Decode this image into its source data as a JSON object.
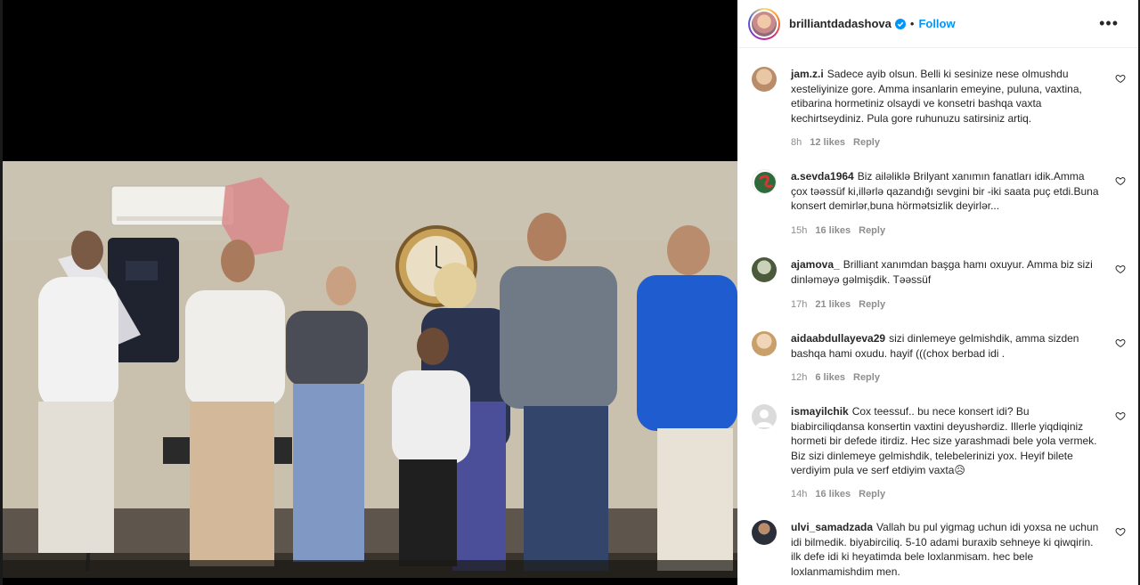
{
  "header": {
    "username": "brilliantdadashova",
    "separator": "•",
    "follow_label": "Follow",
    "more_label": "•••",
    "accent": "#0095f6"
  },
  "comments": [
    {
      "username": "jam.z.i",
      "text": "Sadece ayib olsun. Belli ki sesinize nese olmushdu xesteliyinize gore. Amma insanlarin emeyine, puluna, vaxtina, etibarina hormetiniz olsaydi ve konsetri bashqa vaxta kechirtseydiniz. Pula gore ruhunuzu satirsiniz artiq.",
      "time": "8h",
      "likes": "12 likes",
      "reply": "Reply",
      "avatar_color": "#d9b08c"
    },
    {
      "username": "a.sevda1964",
      "text": "Biz ailəliklə Brilyant xanımın fanatları idik.Amma çox təəssüf ki,illərlə qazandığı sevgini bir -iki saata puç etdi.Buna konsert demirlər,buna hörmətsizlik deyirlər...",
      "time": "15h",
      "likes": "16 likes",
      "reply": "Reply",
      "avatar_color": "#2f6b3a"
    },
    {
      "username": "ajamova_",
      "text": "Brilliant xanımdan başga hamı oxuyur. Amma biz sizi dinləməyə gəlmişdik. Təəssüf",
      "time": "17h",
      "likes": "21 likes",
      "reply": "Reply",
      "avatar_color": "#4a5a3a"
    },
    {
      "username": "aidaabdullayeva29",
      "text": "sizi dinlemeye gelmishdik, amma sizden bashqa hami oxudu. hayif (((chox berbad idi .",
      "time": "12h",
      "likes": "6 likes",
      "reply": "Reply",
      "avatar_color": "#d7b58a"
    },
    {
      "username": "ismayilchik",
      "text": "Cox teessuf.. bu nece konsert idi? Bu biabirciliqdansa konsertin vaxtini deyushərdiz. Illerle yiqdiqiniz hormeti bir defede itirdiz. Hec size yarashmadi bele yola vermek. Biz sizi dinlemeye gelmishdik, telebelerinizi yox. Heyif bilete verdiyim pula ve serf etdiyim vaxta😥",
      "time": "14h",
      "likes": "16 likes",
      "reply": "Reply",
      "avatar_color": "#dbdbdb"
    },
    {
      "username": "ulvi_samadzada",
      "text": "Vallah bu pul yigmag uchun idi yoxsa ne uchun idi bilmedik. biyabirciliq. 5-10 adami buraxib sehneye ki qiwqirin. ilk defe idi ki heyatimda bele loxlanmisam. hec bele loxlanmamishdim men.",
      "time": "",
      "likes": "",
      "reply": "",
      "avatar_color": "#2b2f3a"
    }
  ]
}
